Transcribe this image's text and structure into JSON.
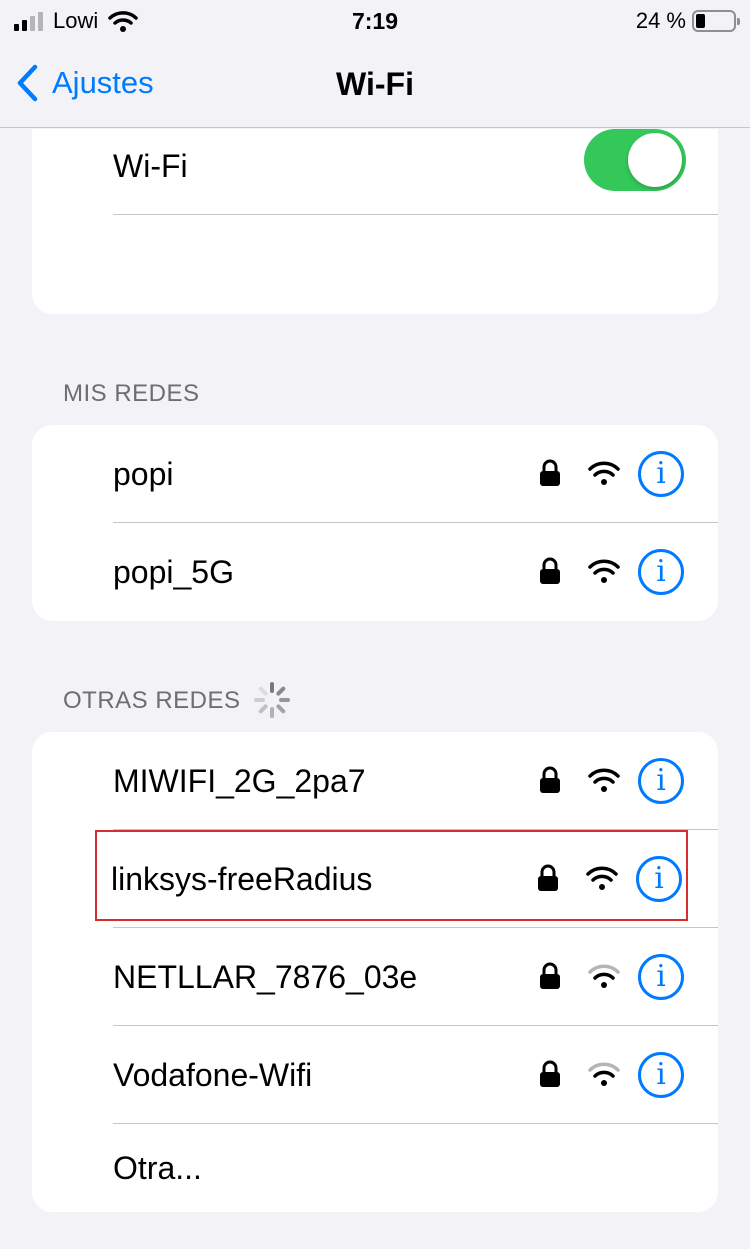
{
  "status_bar": {
    "carrier": "Lowi",
    "time": "7:19",
    "battery_percent": "24 %",
    "battery_level": 0.24,
    "signal_bars_active": 2,
    "icons": [
      "cellular-signal-icon",
      "wifi-status-icon",
      "battery-icon"
    ]
  },
  "nav": {
    "back_label": "Ajustes",
    "title": "Wi-Fi"
  },
  "wifi_toggle": {
    "label": "Wi-Fi",
    "on": true
  },
  "my_networks": {
    "header": "MIS REDES",
    "items": [
      {
        "name": "popi",
        "secured": true,
        "signal": "full"
      },
      {
        "name": "popi_5G",
        "secured": true,
        "signal": "full"
      }
    ]
  },
  "other_networks": {
    "header": "OTRAS REDES",
    "scanning": true,
    "items": [
      {
        "name": "MIWIFI_2G_2pa7",
        "secured": true,
        "signal": "full"
      },
      {
        "name": "linksys-freeRadius",
        "secured": true,
        "signal": "full",
        "highlighted": true
      },
      {
        "name": "NETLLAR_7876_03e",
        "secured": true,
        "signal": "partial"
      },
      {
        "name": "Vodafone-Wifi",
        "secured": true,
        "signal": "partial"
      }
    ],
    "other_label": "Otra..."
  },
  "info_glyph": "i",
  "colors": {
    "accent": "#007aff",
    "toggle_on": "#34c759",
    "background": "#f2f2f7",
    "highlight_border": "#d32f2f"
  }
}
